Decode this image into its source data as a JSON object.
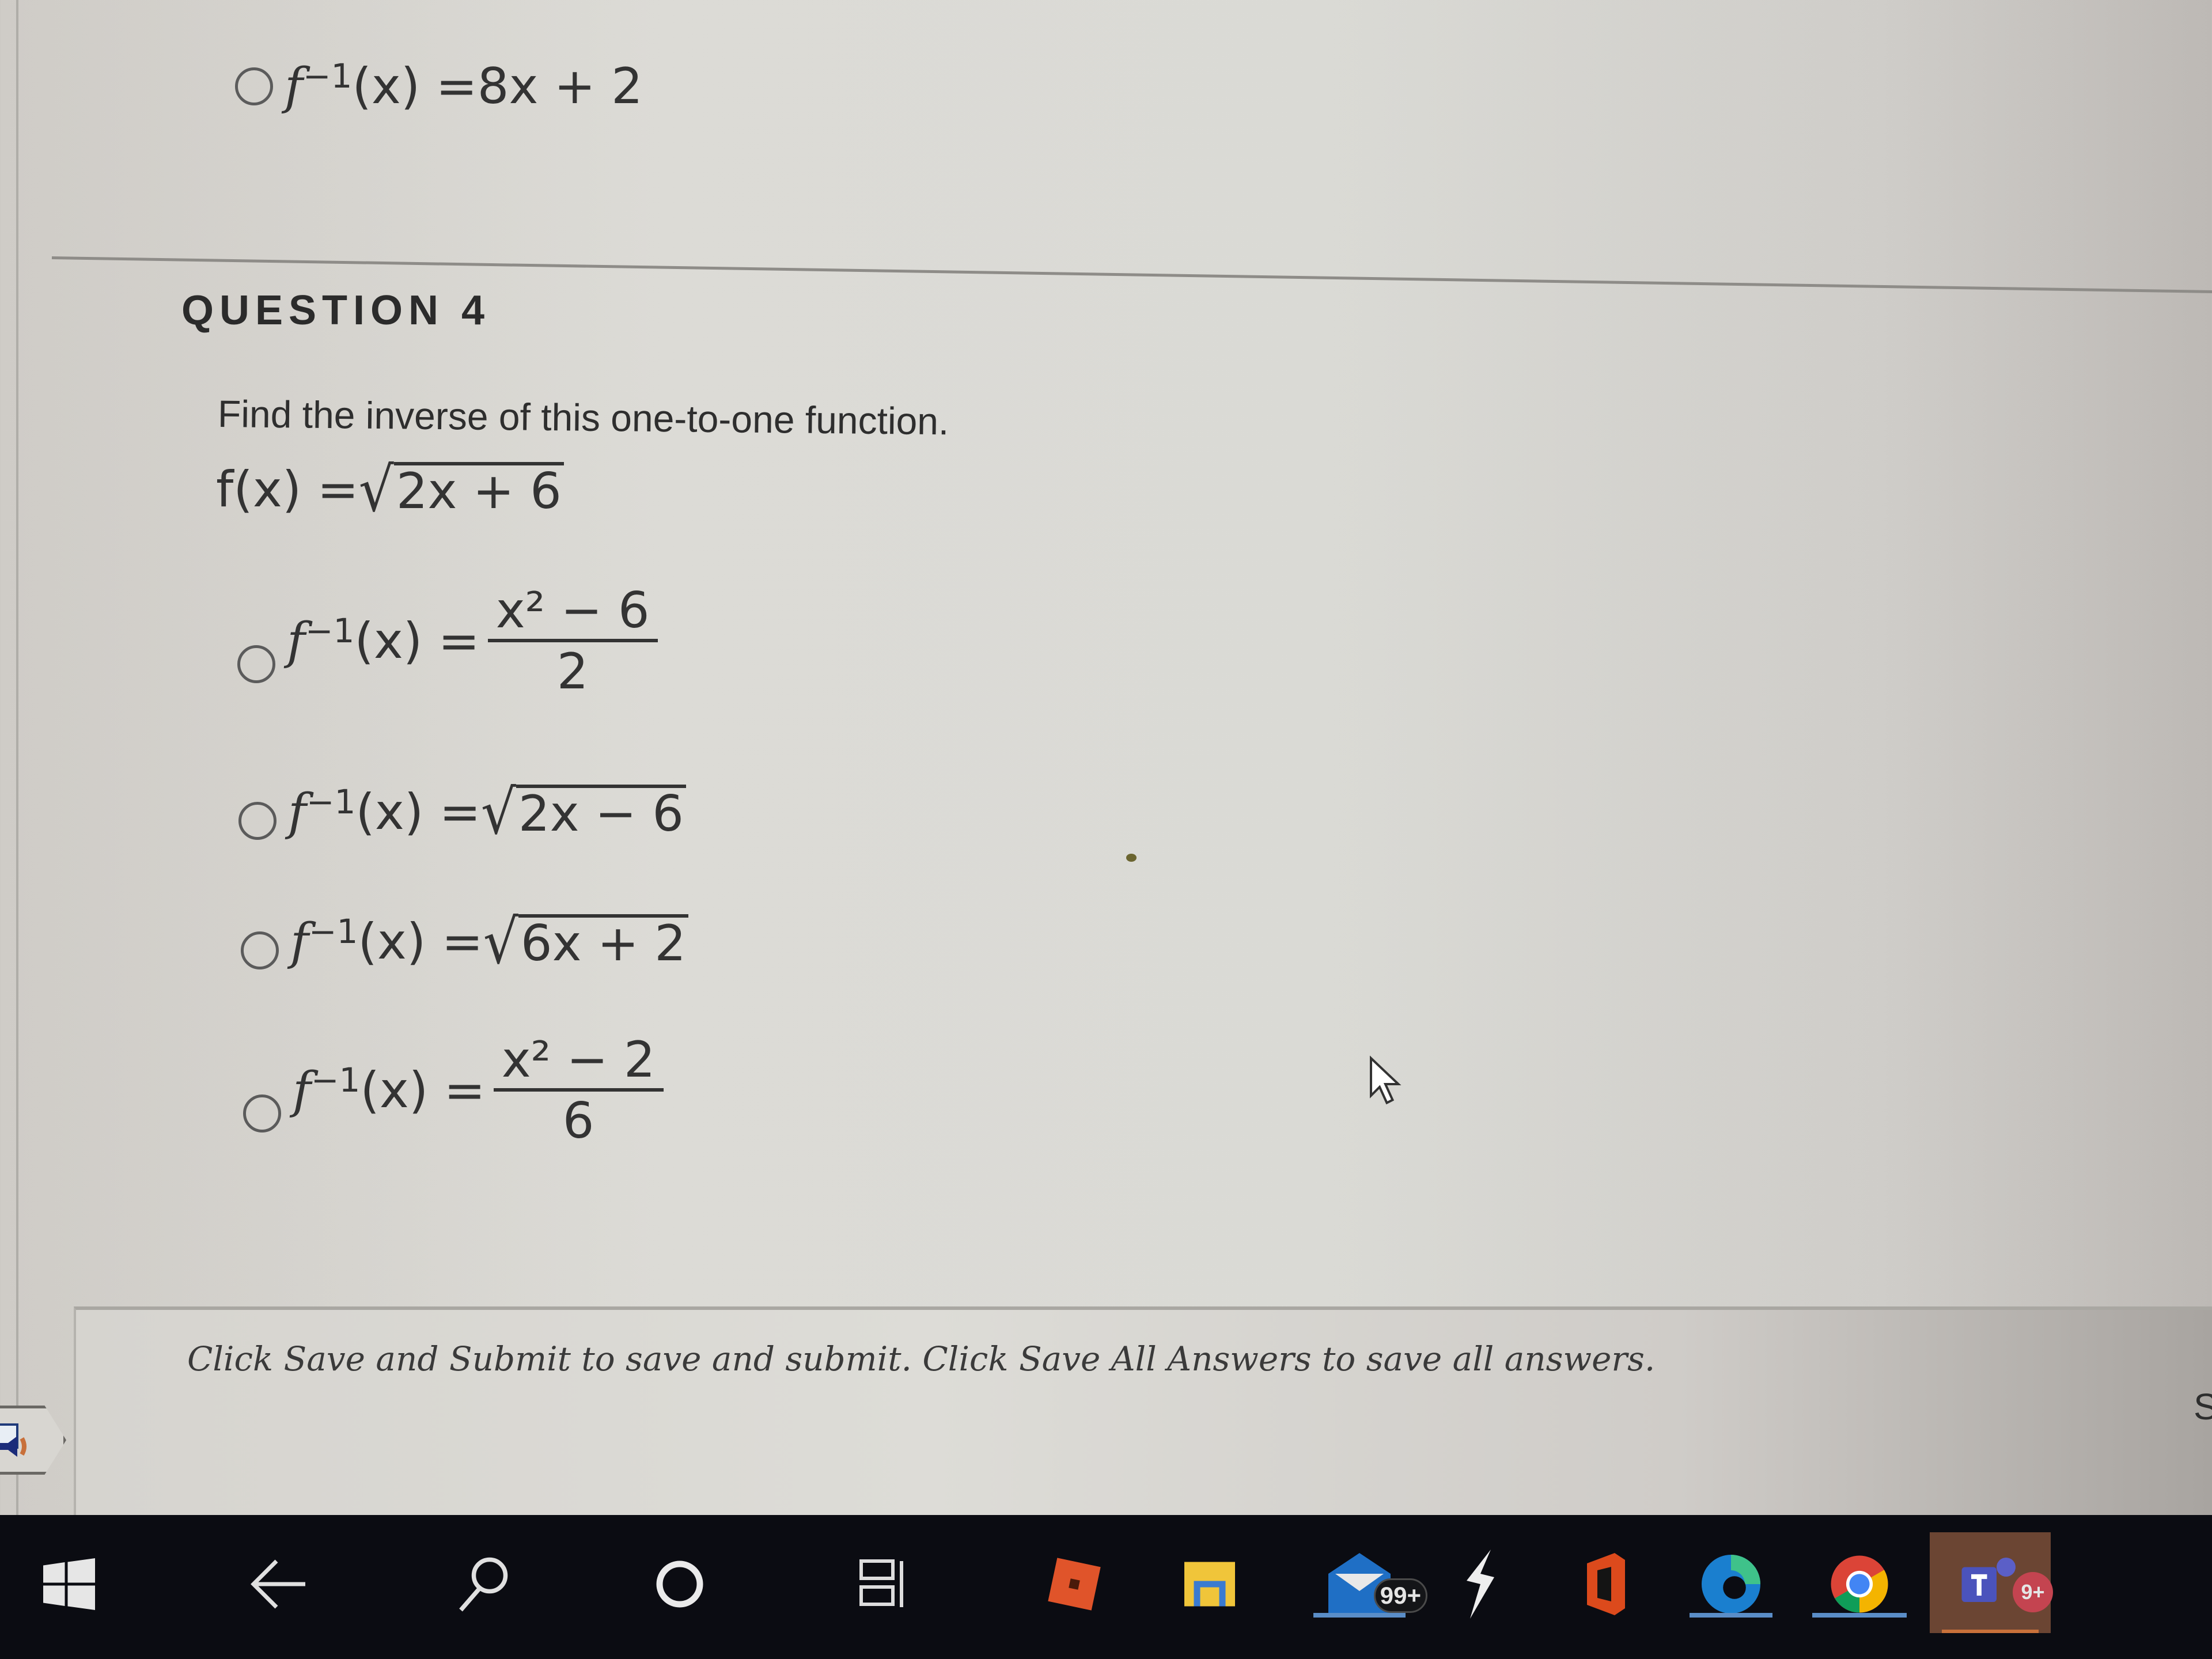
{
  "previous_question": {
    "last_option": {
      "lhs": "f",
      "sup": "−1",
      "arg": "(x) = ",
      "rhs": "8x + 2"
    }
  },
  "question": {
    "title": "QUESTION 4",
    "prompt": "Find the inverse of this one-to-one function.",
    "function": {
      "lhs": "f(x) = ",
      "radicand": "2x + 6"
    },
    "options": [
      {
        "type": "fraction",
        "lhs": "f",
        "sup": "−1",
        "arg": "(x) = ",
        "numerator": "x² − 6",
        "denominator": "2",
        "selected": false
      },
      {
        "type": "sqrt",
        "lhs": "f",
        "sup": "−1",
        "arg": "(x) = ",
        "radicand": "2x − 6",
        "selected": false
      },
      {
        "type": "sqrt",
        "lhs": "f",
        "sup": "−1",
        "arg": "(x) = ",
        "radicand": "6x + 2",
        "selected": false
      },
      {
        "type": "fraction",
        "lhs": "f",
        "sup": "−1",
        "arg": "(x) = ",
        "numerator": "x² − 2",
        "denominator": "6",
        "selected": false
      }
    ]
  },
  "footer": {
    "instructions": "Click Save and Submit to save and submit. Click Save All Answers to save all answers.",
    "cut_off_button_text": "S"
  },
  "taskbar": {
    "items": [
      {
        "name": "start",
        "icon": "windows-logo-icon"
      },
      {
        "name": "back",
        "icon": "back-arrow-icon"
      },
      {
        "name": "search",
        "icon": "search-icon"
      },
      {
        "name": "cortana",
        "icon": "cortana-circle-icon"
      },
      {
        "name": "task-view",
        "icon": "task-view-icon"
      },
      {
        "name": "roblox",
        "icon": "roblox-icon"
      },
      {
        "name": "file-explorer",
        "icon": "folder-icon"
      },
      {
        "name": "mail",
        "icon": "mail-icon",
        "badge": "99+"
      },
      {
        "name": "app-white-bolt",
        "icon": "bolt-icon"
      },
      {
        "name": "office",
        "icon": "office-icon"
      },
      {
        "name": "edge",
        "icon": "edge-icon"
      },
      {
        "name": "chrome",
        "icon": "chrome-icon"
      },
      {
        "name": "teams",
        "icon": "teams-icon",
        "badge": "9+"
      }
    ]
  },
  "colors": {
    "taskbar_bg": "#0b0c12",
    "active_underline": "#5a8dc7",
    "teams_active_bg": "#6b4533",
    "text": "#2a2a2a"
  }
}
